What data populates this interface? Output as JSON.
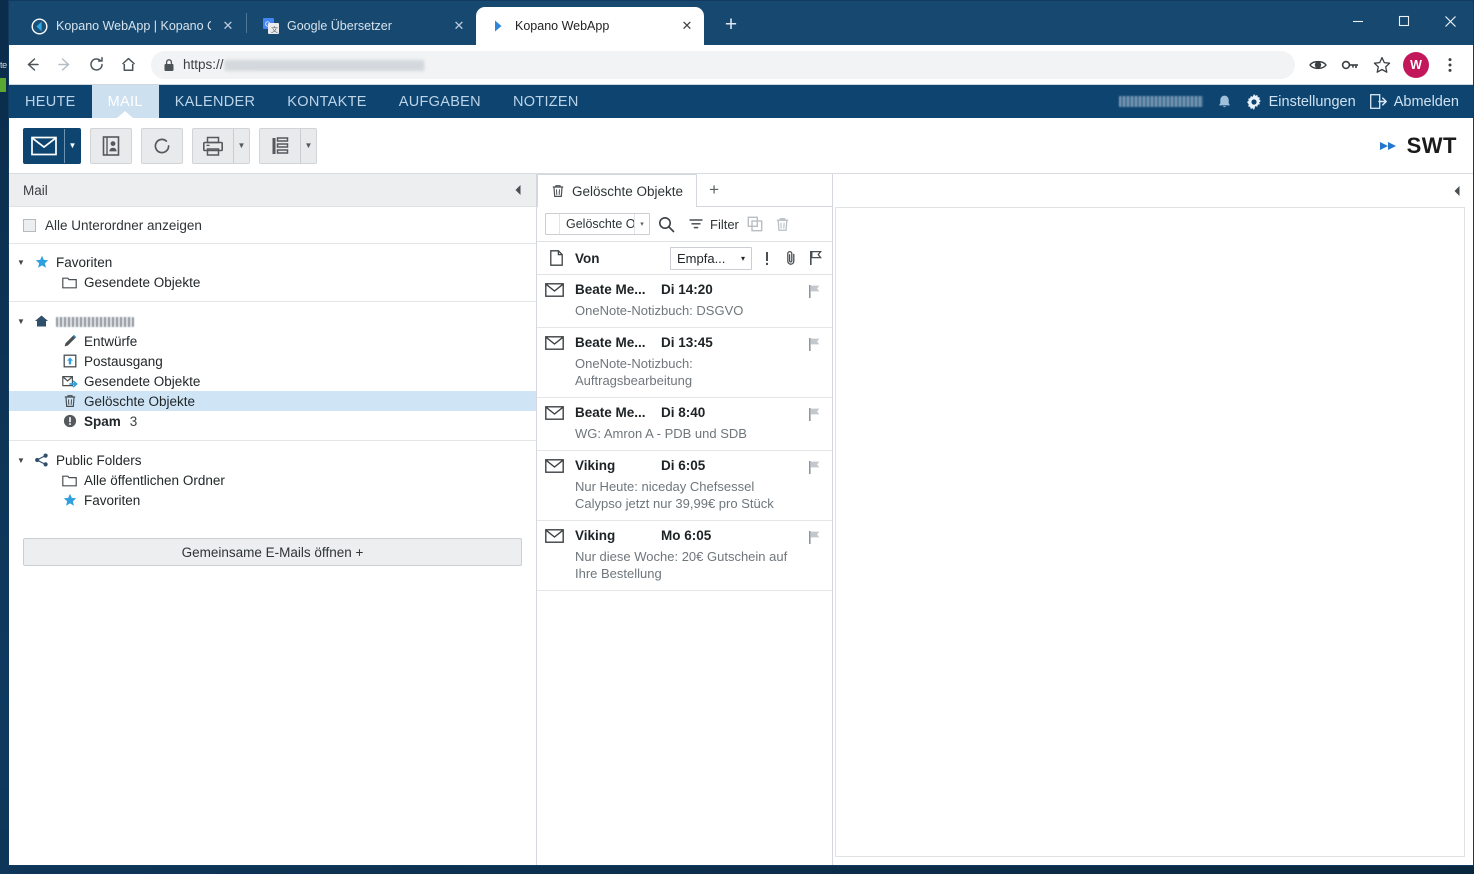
{
  "browser": {
    "tabs": [
      {
        "title": "Kopano WebApp | Kopano Comm",
        "favicon": "kopano-icon",
        "active": false,
        "close": "✕"
      },
      {
        "title": "Google Übersetzer",
        "favicon": "google-translate-icon",
        "active": false,
        "close": "✕"
      },
      {
        "title": "Kopano WebApp",
        "favicon": "kopano-chevron-icon",
        "active": true,
        "close": "✕"
      }
    ],
    "new_tab_label": "+",
    "window_controls": {
      "minimize": "minimize-icon",
      "maximize": "maximize-icon",
      "close": "close-icon"
    },
    "nav": {
      "back": "back-arrow-icon",
      "forward": "forward-arrow-icon",
      "reload": "reload-icon",
      "home": "home-icon"
    },
    "url": {
      "scheme": "https://",
      "lock": "lock-icon",
      "redacted": true
    },
    "toolbar_icons": [
      "eye-icon",
      "key-icon",
      "bookmark-star-icon"
    ],
    "profile_avatar": "W",
    "menu": "three-dot-menu-icon"
  },
  "kopano": {
    "nav_items": [
      {
        "label": "HEUTE",
        "active": false
      },
      {
        "label": "MAIL",
        "active": true
      },
      {
        "label": "KALENDER",
        "active": false
      },
      {
        "label": "KONTAKTE",
        "active": false
      },
      {
        "label": "AUFGABEN",
        "active": false
      },
      {
        "label": "NOTIZEN",
        "active": false
      }
    ],
    "nav_right": {
      "username_redacted": true,
      "bell": "bell-icon",
      "settings_label": "Einstellungen",
      "settings_icon": "gear-icon",
      "logout_label": "Abmelden",
      "logout_icon": "logout-icon"
    },
    "toolbar_buttons": [
      {
        "name": "new-mail",
        "icon": "envelope-icon",
        "primary": true,
        "has_arrow": true
      },
      {
        "name": "address-book",
        "icon": "address-book-icon",
        "primary": false,
        "has_arrow": false
      },
      {
        "name": "refresh",
        "icon": "refresh-icon",
        "primary": false,
        "has_arrow": false
      },
      {
        "name": "print",
        "icon": "printer-icon",
        "primary": false,
        "has_arrow": true
      },
      {
        "name": "view-layout",
        "icon": "list-layout-icon",
        "primary": false,
        "has_arrow": true
      }
    ],
    "brand": {
      "text": "SWT",
      "chevron_color": "#1f6fc4"
    },
    "accent_color": "#0e4470",
    "selection_color": "#cfe5f6"
  },
  "folder_pane": {
    "header": "Mail",
    "collapse_icon": "collapse-left-icon",
    "show_subfolders_label": "Alle Unterordner anzeigen",
    "show_subfolders_checked": false,
    "groups": [
      {
        "root": {
          "label": "Favoriten",
          "icon": "star-icon",
          "caret": "▼",
          "bold": false
        },
        "children": [
          {
            "label": "Gesendete Objekte",
            "icon": "folder-icon",
            "selected": false,
            "count": ""
          }
        ]
      },
      {
        "root": {
          "label": "",
          "icon": "home-icon",
          "caret": "▼",
          "redacted": true
        },
        "children": [
          {
            "label": "Entwürfe",
            "icon": "pencil-icon",
            "selected": false,
            "count": ""
          },
          {
            "label": "Postausgang",
            "icon": "outbox-icon",
            "selected": false,
            "count": ""
          },
          {
            "label": "Gesendete Objekte",
            "icon": "sent-icon",
            "selected": false,
            "count": ""
          },
          {
            "label": "Gelöschte Objekte",
            "icon": "trash-icon",
            "selected": true,
            "count": ""
          },
          {
            "label": "Spam",
            "icon": "alert-icon",
            "selected": false,
            "count": "3",
            "bold": true
          }
        ]
      },
      {
        "root": {
          "label": "Public Folders",
          "icon": "share-icon",
          "caret": "▼",
          "bold": false
        },
        "children": [
          {
            "label": "Alle öffentlichen Ordner",
            "icon": "folder-icon",
            "selected": false,
            "count": ""
          },
          {
            "label": "Favoriten",
            "icon": "star-icon",
            "selected": false,
            "count": ""
          }
        ]
      }
    ],
    "shared_button": "Gemeinsame E-Mails öffnen +"
  },
  "list_pane": {
    "folder_tab": {
      "label": "Gelöschte Objekte",
      "icon": "trash-icon"
    },
    "add_tab": "+",
    "search": {
      "scope_value": "Gelöschte O",
      "scope_arrow": "▾",
      "search_icon": "magnifier-icon",
      "filter_label": "Filter",
      "filter_icon": "filter-icon",
      "copy_icon": "copy-icon",
      "delete_icon": "trash-icon"
    },
    "columns": {
      "attachment_icon": "page-icon",
      "from_label": "Von",
      "sort_value": "Empfa...",
      "sort_arrow": "▾",
      "priority_icon": "exclamation-icon",
      "paperclip_icon": "paperclip-icon",
      "flag_icon": "flag-icon"
    },
    "messages": [
      {
        "from": "Beate Me...",
        "date": "Di 14:20",
        "subject": "OneNote-Notizbuch: DSGVO",
        "unread": false,
        "flag": "flag-icon"
      },
      {
        "from": "Beate Me...",
        "date": "Di 13:45",
        "subject": "OneNote-Notizbuch: Auftragsbearbeitung",
        "unread": false,
        "flag": "flag-icon"
      },
      {
        "from": "Beate Me...",
        "date": "Di 8:40",
        "subject": "WG: Amron A - PDB und SDB",
        "unread": false,
        "flag": "flag-icon"
      },
      {
        "from": "Viking",
        "date": "Di 6:05",
        "subject": "Nur Heute: niceday Chefsessel Calypso jetzt nur 39,99€ pro Stück",
        "unread": false,
        "flag": "flag-icon"
      },
      {
        "from": "Viking",
        "date": "Mo 6:05",
        "subject": "Nur diese Woche: 20€ Gutschein auf Ihre Bestellung",
        "unread": false,
        "flag": "flag-icon"
      }
    ]
  },
  "preview_pane": {
    "collapse_icon": "collapse-right-icon",
    "content": ""
  },
  "desktop": {
    "strip_text": "te"
  }
}
